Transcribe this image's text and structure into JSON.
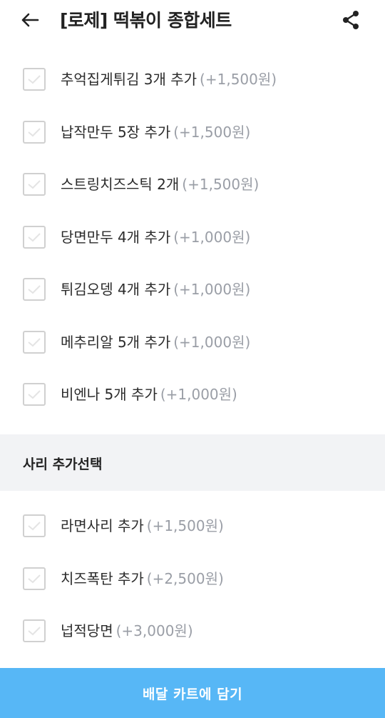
{
  "header": {
    "title": "[로제] 떡볶이 종합세트"
  },
  "options_top": [
    {
      "name": "추억집게튀김 3개 추가",
      "price": "(+1,500원)"
    },
    {
      "name": "납작만두 5장 추가",
      "price": "(+1,500원)"
    },
    {
      "name": "스트링치즈스틱 2개",
      "price": "(+1,500원)"
    },
    {
      "name": "당면만두 4개 추가",
      "price": "(+1,000원)"
    },
    {
      "name": "튀김오뎅 4개 추가",
      "price": "(+1,000원)"
    },
    {
      "name": "메추리알 5개 추가",
      "price": "(+1,000원)"
    },
    {
      "name": "비엔나 5개 추가",
      "price": "(+1,000원)"
    }
  ],
  "sari_section": {
    "title": "사리 추가선택",
    "options": [
      {
        "name": "라면사리 추가",
        "price": "(+1,500원)"
      },
      {
        "name": "치즈폭탄 추가",
        "price": "(+2,500원)"
      },
      {
        "name": "넙적당면",
        "price": "(+3,000원)"
      }
    ]
  },
  "cart_button": {
    "label": "배달 카트에 담기"
  },
  "colors": {
    "accent": "#57b7f6",
    "section_bg": "#f2f3f5",
    "price_text": "#9a9ea6",
    "checkbox_border": "#d0d0d0"
  },
  "icons": {
    "back": "arrow-left",
    "share": "share-nodes",
    "checkbox": "checkmark"
  }
}
